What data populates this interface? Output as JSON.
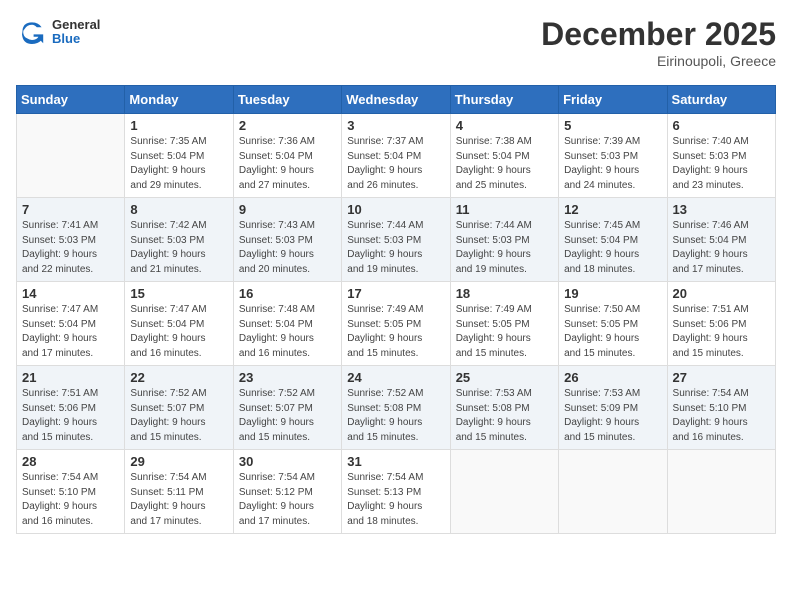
{
  "header": {
    "logo_general": "General",
    "logo_blue": "Blue",
    "month_title": "December 2025",
    "location": "Eirinoupoli, Greece"
  },
  "days_of_week": [
    "Sunday",
    "Monday",
    "Tuesday",
    "Wednesday",
    "Thursday",
    "Friday",
    "Saturday"
  ],
  "weeks": [
    {
      "shaded": false,
      "days": [
        {
          "num": "",
          "info": ""
        },
        {
          "num": "1",
          "info": "Sunrise: 7:35 AM\nSunset: 5:04 PM\nDaylight: 9 hours\nand 29 minutes."
        },
        {
          "num": "2",
          "info": "Sunrise: 7:36 AM\nSunset: 5:04 PM\nDaylight: 9 hours\nand 27 minutes."
        },
        {
          "num": "3",
          "info": "Sunrise: 7:37 AM\nSunset: 5:04 PM\nDaylight: 9 hours\nand 26 minutes."
        },
        {
          "num": "4",
          "info": "Sunrise: 7:38 AM\nSunset: 5:04 PM\nDaylight: 9 hours\nand 25 minutes."
        },
        {
          "num": "5",
          "info": "Sunrise: 7:39 AM\nSunset: 5:03 PM\nDaylight: 9 hours\nand 24 minutes."
        },
        {
          "num": "6",
          "info": "Sunrise: 7:40 AM\nSunset: 5:03 PM\nDaylight: 9 hours\nand 23 minutes."
        }
      ]
    },
    {
      "shaded": true,
      "days": [
        {
          "num": "7",
          "info": "Sunrise: 7:41 AM\nSunset: 5:03 PM\nDaylight: 9 hours\nand 22 minutes."
        },
        {
          "num": "8",
          "info": "Sunrise: 7:42 AM\nSunset: 5:03 PM\nDaylight: 9 hours\nand 21 minutes."
        },
        {
          "num": "9",
          "info": "Sunrise: 7:43 AM\nSunset: 5:03 PM\nDaylight: 9 hours\nand 20 minutes."
        },
        {
          "num": "10",
          "info": "Sunrise: 7:44 AM\nSunset: 5:03 PM\nDaylight: 9 hours\nand 19 minutes."
        },
        {
          "num": "11",
          "info": "Sunrise: 7:44 AM\nSunset: 5:03 PM\nDaylight: 9 hours\nand 19 minutes."
        },
        {
          "num": "12",
          "info": "Sunrise: 7:45 AM\nSunset: 5:04 PM\nDaylight: 9 hours\nand 18 minutes."
        },
        {
          "num": "13",
          "info": "Sunrise: 7:46 AM\nSunset: 5:04 PM\nDaylight: 9 hours\nand 17 minutes."
        }
      ]
    },
    {
      "shaded": false,
      "days": [
        {
          "num": "14",
          "info": "Sunrise: 7:47 AM\nSunset: 5:04 PM\nDaylight: 9 hours\nand 17 minutes."
        },
        {
          "num": "15",
          "info": "Sunrise: 7:47 AM\nSunset: 5:04 PM\nDaylight: 9 hours\nand 16 minutes."
        },
        {
          "num": "16",
          "info": "Sunrise: 7:48 AM\nSunset: 5:04 PM\nDaylight: 9 hours\nand 16 minutes."
        },
        {
          "num": "17",
          "info": "Sunrise: 7:49 AM\nSunset: 5:05 PM\nDaylight: 9 hours\nand 15 minutes."
        },
        {
          "num": "18",
          "info": "Sunrise: 7:49 AM\nSunset: 5:05 PM\nDaylight: 9 hours\nand 15 minutes."
        },
        {
          "num": "19",
          "info": "Sunrise: 7:50 AM\nSunset: 5:05 PM\nDaylight: 9 hours\nand 15 minutes."
        },
        {
          "num": "20",
          "info": "Sunrise: 7:51 AM\nSunset: 5:06 PM\nDaylight: 9 hours\nand 15 minutes."
        }
      ]
    },
    {
      "shaded": true,
      "days": [
        {
          "num": "21",
          "info": "Sunrise: 7:51 AM\nSunset: 5:06 PM\nDaylight: 9 hours\nand 15 minutes."
        },
        {
          "num": "22",
          "info": "Sunrise: 7:52 AM\nSunset: 5:07 PM\nDaylight: 9 hours\nand 15 minutes."
        },
        {
          "num": "23",
          "info": "Sunrise: 7:52 AM\nSunset: 5:07 PM\nDaylight: 9 hours\nand 15 minutes."
        },
        {
          "num": "24",
          "info": "Sunrise: 7:52 AM\nSunset: 5:08 PM\nDaylight: 9 hours\nand 15 minutes."
        },
        {
          "num": "25",
          "info": "Sunrise: 7:53 AM\nSunset: 5:08 PM\nDaylight: 9 hours\nand 15 minutes."
        },
        {
          "num": "26",
          "info": "Sunrise: 7:53 AM\nSunset: 5:09 PM\nDaylight: 9 hours\nand 15 minutes."
        },
        {
          "num": "27",
          "info": "Sunrise: 7:54 AM\nSunset: 5:10 PM\nDaylight: 9 hours\nand 16 minutes."
        }
      ]
    },
    {
      "shaded": false,
      "days": [
        {
          "num": "28",
          "info": "Sunrise: 7:54 AM\nSunset: 5:10 PM\nDaylight: 9 hours\nand 16 minutes."
        },
        {
          "num": "29",
          "info": "Sunrise: 7:54 AM\nSunset: 5:11 PM\nDaylight: 9 hours\nand 17 minutes."
        },
        {
          "num": "30",
          "info": "Sunrise: 7:54 AM\nSunset: 5:12 PM\nDaylight: 9 hours\nand 17 minutes."
        },
        {
          "num": "31",
          "info": "Sunrise: 7:54 AM\nSunset: 5:13 PM\nDaylight: 9 hours\nand 18 minutes."
        },
        {
          "num": "",
          "info": ""
        },
        {
          "num": "",
          "info": ""
        },
        {
          "num": "",
          "info": ""
        }
      ]
    }
  ]
}
